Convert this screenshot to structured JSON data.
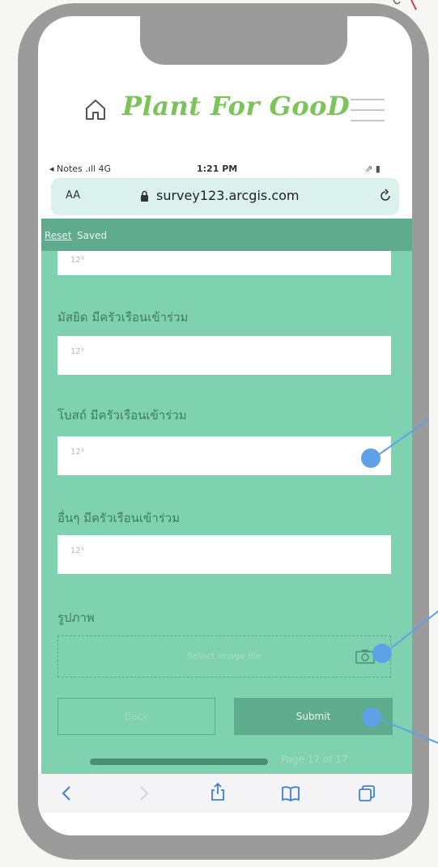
{
  "site": {
    "brand": "Plant For GooD"
  },
  "status_bar": {
    "carrier": "◂ Notes .ıll 4G",
    "time": "1:21 PM",
    "indicators": "⇗ ▮"
  },
  "browser": {
    "text_size": "AA",
    "url": "survey123.arcgis.com"
  },
  "form": {
    "reset_label": "Reset",
    "saved_label": "Saved",
    "placeholder": "12³",
    "questions": [
      {
        "label": "มัสยิด มีครัวเรือนเข้าร่วม"
      },
      {
        "label": "โบสถ์ มีครัวเรือนเข้าร่วม"
      },
      {
        "label": "อื่นๆ มีครัวเรือนเข้าร่วม"
      }
    ],
    "image_question": "รูปภาพ",
    "image_button": "Select image file",
    "back_label": "Back",
    "submit_label": "Submit",
    "page_indicator": "Page 17 of 17"
  },
  "colors": {
    "brand_green": "#7cc45a",
    "form_bg": "#7fd2b0",
    "form_dark": "#5fab8e",
    "callout_blue": "#5ea1e6"
  },
  "icons": [
    "home-icon",
    "hamburger-menu-icon",
    "lock-icon",
    "reload-icon",
    "camera-icon",
    "back-arrow-icon",
    "forward-arrow-icon",
    "share-icon",
    "bookmarks-icon",
    "tabs-icon"
  ]
}
